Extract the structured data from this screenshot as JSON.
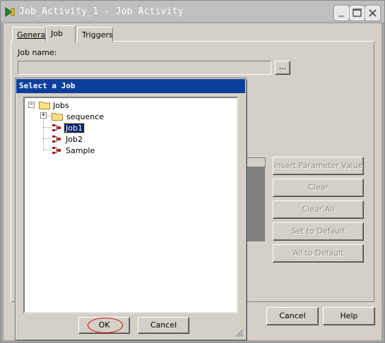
{
  "window": {
    "title": "Job_Activity_1 - Job Activity"
  },
  "tabs": [
    {
      "label": "General",
      "mnemonic_index": 0
    },
    {
      "label": "Job",
      "mnemonic_index": 0
    },
    {
      "label": "Triggers",
      "mnemonic_index": 0
    }
  ],
  "job_name": {
    "label": "Job name:",
    "value": "",
    "browse_label": "..."
  },
  "side_buttons": [
    "Insert Parameter Value",
    "Clear",
    "Clear All",
    "Set to Default",
    "All to Default"
  ],
  "bottom_buttons": {
    "cancel": "Cancel",
    "help": "Help"
  },
  "dialog": {
    "title": "Select a Job",
    "tree": {
      "root": "Jobs",
      "folder": "sequence",
      "items": [
        "Job1",
        "Job2",
        "Sample"
      ],
      "selected": "Job1"
    },
    "ok_label": "OK",
    "cancel_label": "Cancel"
  },
  "colors": {
    "dialog_title_bg": "#0c3f9c",
    "selection_bg": "#0a246a",
    "highlight_ellipse": "#d00000"
  }
}
